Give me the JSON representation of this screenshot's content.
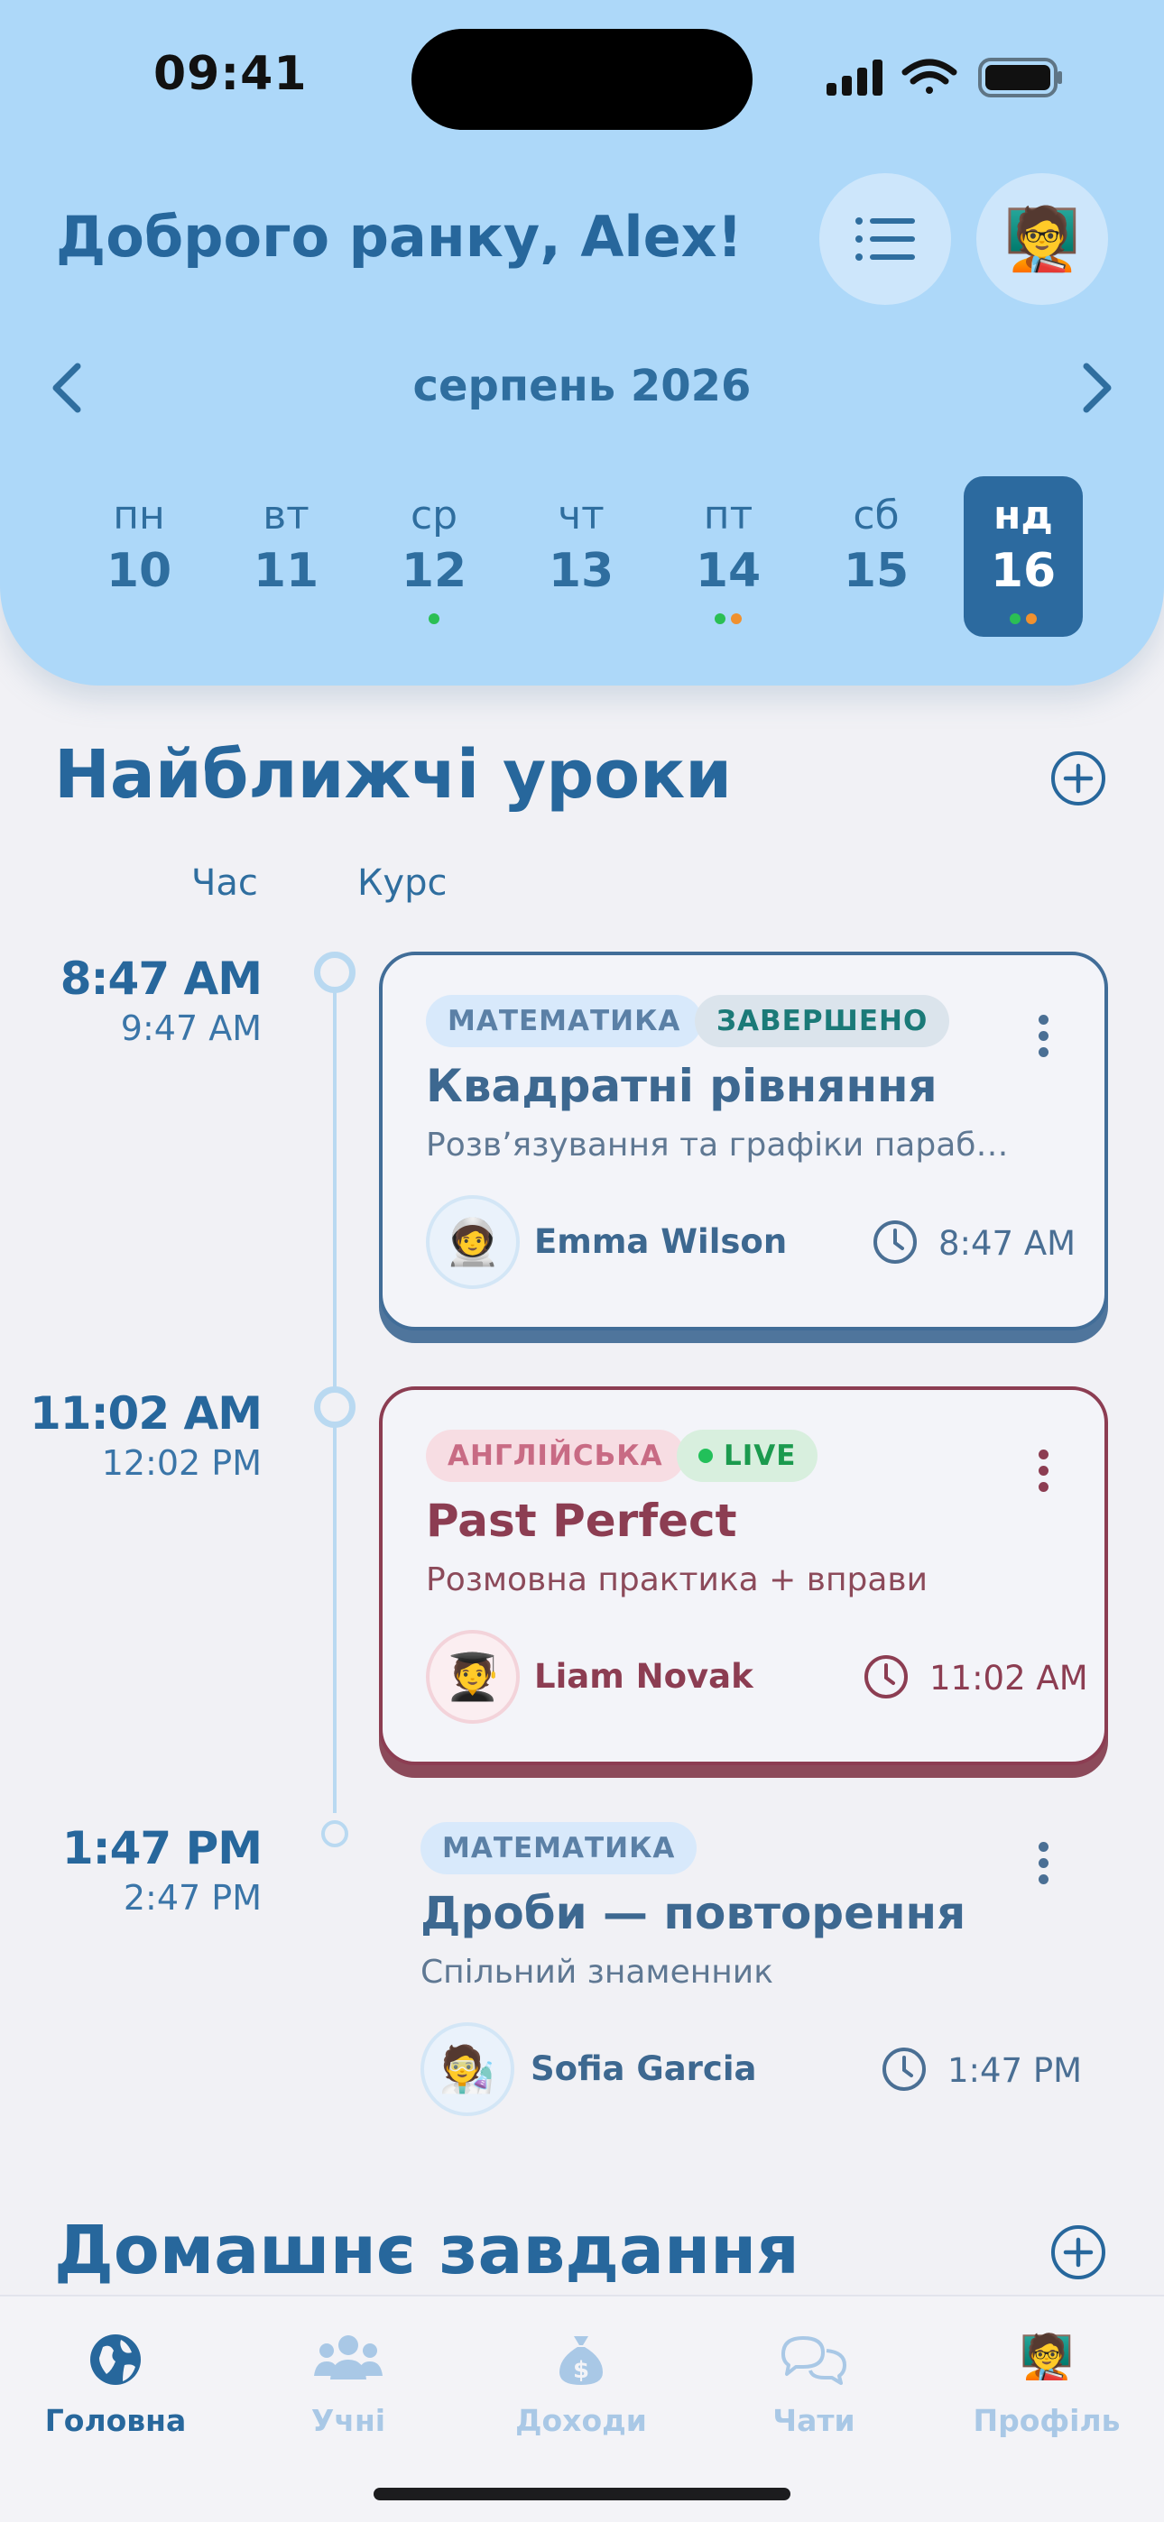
{
  "status": {
    "time": "09:41"
  },
  "header": {
    "greeting": "Доброго ранку, Alex!",
    "menu_icon": "list-icon",
    "avatar_emoji": "🧑‍🏫"
  },
  "calendar": {
    "month": "серпень 2026",
    "days": [
      {
        "name": "пн",
        "date": "10",
        "dots": []
      },
      {
        "name": "вт",
        "date": "11",
        "dots": []
      },
      {
        "name": "ср",
        "date": "12",
        "dots": [
          "#2bbf54"
        ]
      },
      {
        "name": "чт",
        "date": "13",
        "dots": []
      },
      {
        "name": "пт",
        "date": "14",
        "dots": [
          "#2bbf54",
          "#f0912f"
        ]
      },
      {
        "name": "сб",
        "date": "15",
        "dots": []
      },
      {
        "name": "нд",
        "date": "16",
        "dots": [
          "#2bbf54",
          "#f0912f"
        ],
        "selected": true
      }
    ]
  },
  "lessons_section": {
    "title": "Найближчі уроки",
    "col_time": "Час",
    "col_course": "Курс",
    "lessons": [
      {
        "start": "8:47 AM",
        "end": "9:47 AM",
        "subject": "МАТЕМАТИКА",
        "status": "ЗАВЕРШЕНО",
        "title": "Квадратні рівняння",
        "subtitle": "Розв’язування та графіки параб…",
        "student": "Emma Wilson",
        "student_emoji": "🧑‍🚀",
        "time": "8:47 AM"
      },
      {
        "start": "11:02 AM",
        "end": "12:02 PM",
        "subject": "АНГЛІЙСЬКА",
        "status": "LIVE",
        "title": "Past Perfect",
        "subtitle": "Розмовна практика + вправи",
        "student": "Liam Novak",
        "student_emoji": "🧑‍🎓",
        "time": "11:02 AM"
      },
      {
        "start": "1:47 PM",
        "end": "2:47 PM",
        "subject": "МАТЕМАТИКА",
        "title": "Дроби — повторення",
        "subtitle": "Спільний знаменник",
        "student": "Sofia Garcia",
        "student_emoji": "🧑‍🔬",
        "time": "1:47 PM"
      }
    ]
  },
  "homework_section": {
    "title": "Домашнє завдання"
  },
  "tabbar": {
    "tabs": [
      {
        "label": "Головна",
        "icon": "globe-icon",
        "active": true
      },
      {
        "label": "Учні",
        "icon": "users-icon"
      },
      {
        "label": "Доходи",
        "icon": "money-bag-icon"
      },
      {
        "label": "Чати",
        "icon": "chat-bubbles-icon"
      },
      {
        "label": "Профіль",
        "icon": "teacher-avatar-icon",
        "emoji": "🧑‍🏫"
      }
    ]
  },
  "colors": {
    "header_bg": "#add8f9",
    "primary": "#27679c",
    "live_green": "#22c05a",
    "english_accent": "#8c3d52"
  }
}
